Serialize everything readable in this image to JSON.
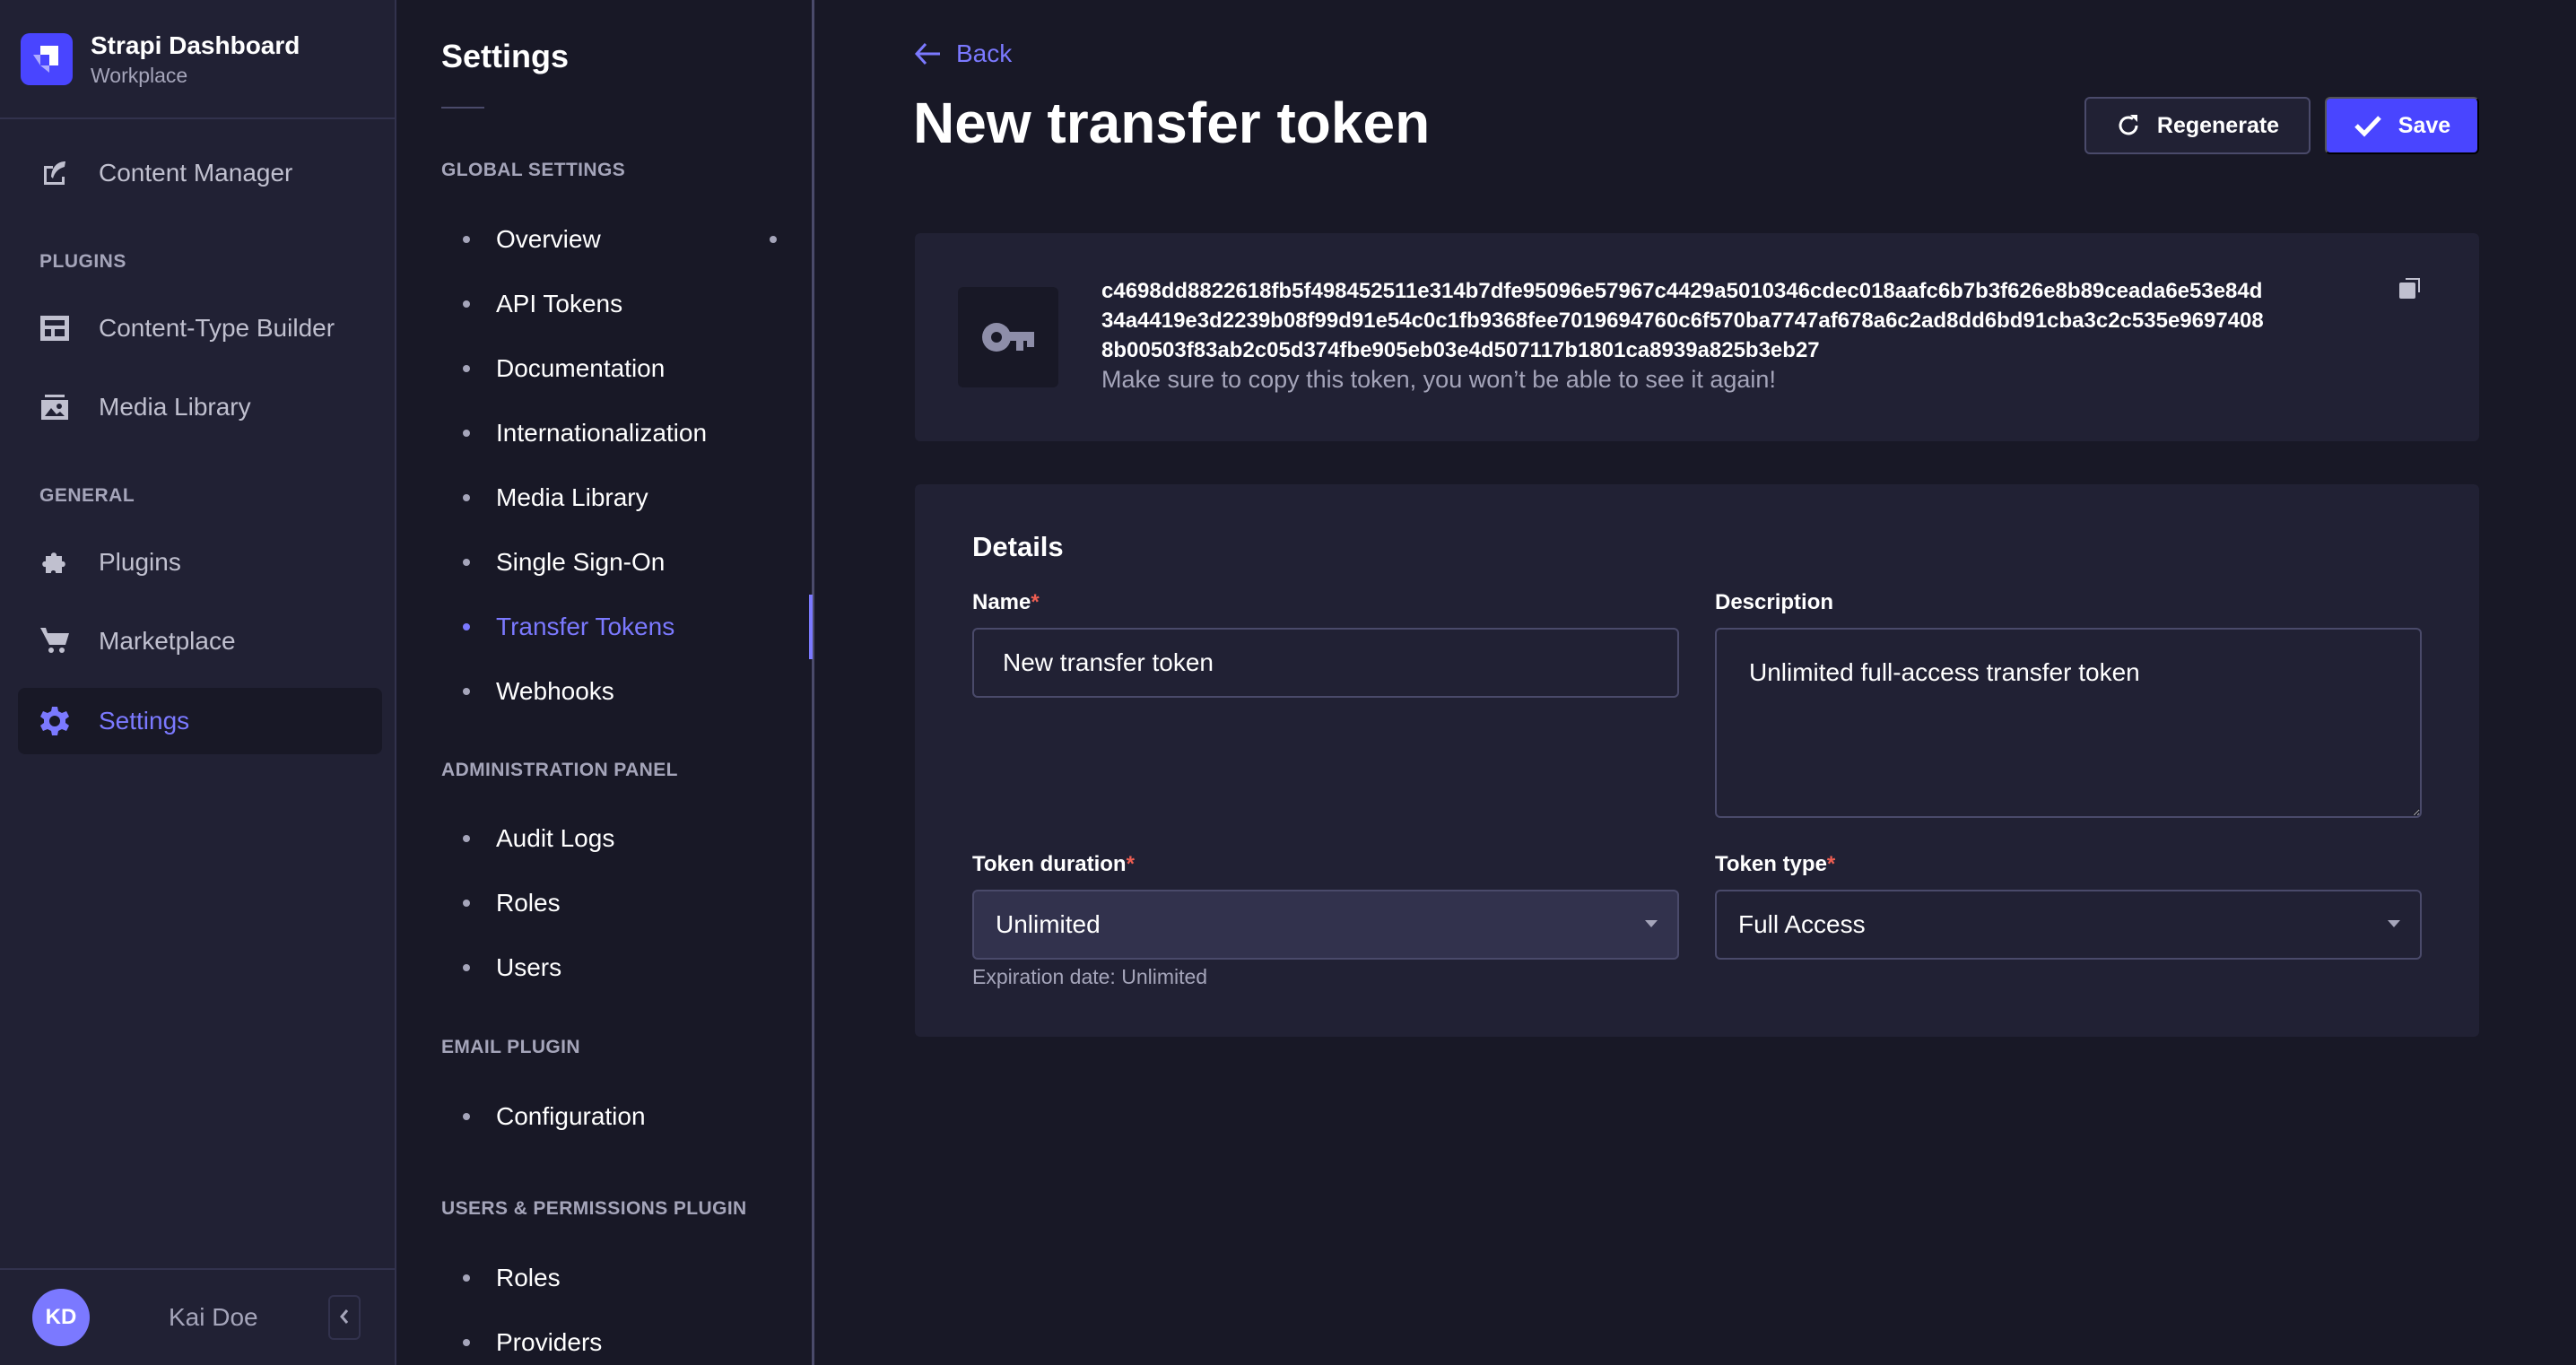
{
  "brand": {
    "title": "Strapi Dashboard",
    "subtitle": "Workplace",
    "color": "#4945ff"
  },
  "mainnav": {
    "items": [
      {
        "label": "Content Manager",
        "icon": "feather-icon"
      },
      {
        "label": "Content-Type Builder",
        "icon": "layout-icon"
      },
      {
        "label": "Media Library",
        "icon": "picture-icon"
      },
      {
        "label": "Plugins",
        "icon": "puzzle-icon"
      },
      {
        "label": "Marketplace",
        "icon": "cart-icon"
      },
      {
        "label": "Settings",
        "icon": "gear-icon",
        "active": true
      }
    ],
    "sections": {
      "plugins": "PLUGINS",
      "general": "GENERAL"
    },
    "user": {
      "initials": "KD",
      "name": "Kai Doe"
    }
  },
  "subnav": {
    "title": "Settings",
    "sections": [
      {
        "title": "GLOBAL SETTINGS",
        "items": [
          "Overview",
          "API Tokens",
          "Documentation",
          "Internationalization",
          "Media Library",
          "Single Sign-On",
          "Transfer Tokens",
          "Webhooks"
        ]
      },
      {
        "title": "ADMINISTRATION PANEL",
        "items": [
          "Audit Logs",
          "Roles",
          "Users"
        ]
      },
      {
        "title": "EMAIL PLUGIN",
        "items": [
          "Configuration"
        ]
      },
      {
        "title": "USERS & PERMISSIONS PLUGIN",
        "items": [
          "Roles",
          "Providers"
        ]
      }
    ],
    "active_item": "Transfer Tokens"
  },
  "header": {
    "back_label": "Back",
    "title": "New transfer token",
    "regenerate_label": "Regenerate",
    "save_label": "Save"
  },
  "token": {
    "lines": [
      "c4698dd8822618fb5f498452511e314b7dfe95096e57967c4429a5010346cdec018aafc6b7b3f626e8b89ceada6e53e84d",
      "34a4419e3d2239b08f99d91e54c0c1fb9368fee7019694760c6f570ba7747af678a6c2ad8dd6bd91cba3c2c535e9697408",
      "8b00503f83ab2c05d374fbe905eb03e4d507117b1801ca8939a825b3eb27"
    ],
    "hint": "Make sure to copy this token, you won’t be able to see it again!"
  },
  "details": {
    "title": "Details",
    "name_label": "Name",
    "name_value": "New transfer token",
    "description_label": "Description",
    "description_value": "Unlimited full-access transfer token",
    "duration_label": "Token duration",
    "duration_value": "Unlimited",
    "duration_hint": "Expiration date: Unlimited",
    "type_label": "Token type",
    "type_value": "Full Access",
    "required_marker": "*"
  },
  "colors": {
    "accent": "#7b79ff",
    "primary": "#4945ff",
    "required": "#ee5e52"
  }
}
